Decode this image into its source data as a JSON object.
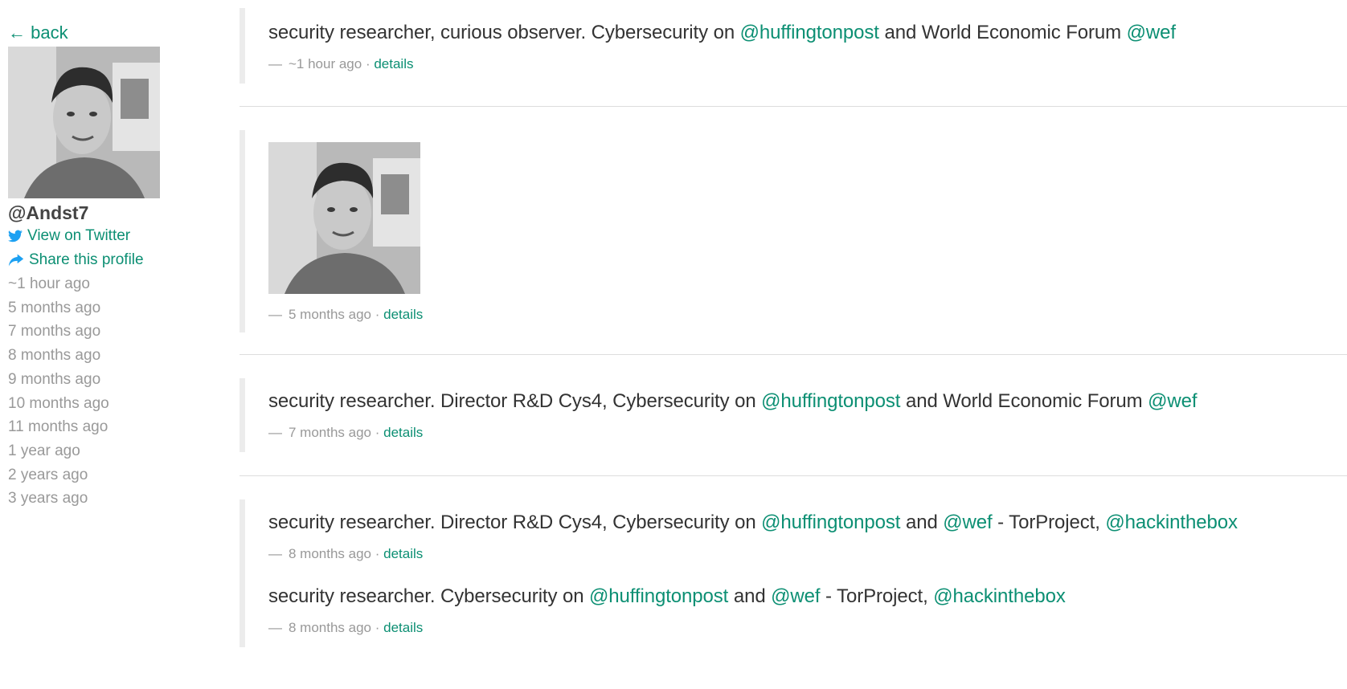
{
  "sidebar": {
    "back": "← back",
    "handle": "@Andst7",
    "view_twitter": "View on Twitter",
    "share_profile": "Share this profile",
    "timeline": [
      "~1 hour ago",
      "5 months ago",
      "7 months ago",
      "8 months ago",
      "9 months ago",
      "10 months ago",
      "11 months ago",
      "1 year ago",
      "2 years ago",
      "3 years ago"
    ]
  },
  "entries": {
    "e1": {
      "bio_pre": "security researcher, curious observer. Cybersecurity on ",
      "m1": "@huffingtonpost",
      "mid": " and World Economic Forum ",
      "m2": "@wef",
      "time": "~1 hour ago",
      "details": "details"
    },
    "e2": {
      "time": "5 months ago",
      "details": "details"
    },
    "e3": {
      "bio_pre": "security researcher. Director R&D Cys4, Cybersecurity on ",
      "m1": "@huffingtonpost",
      "mid": " and World Economic Forum ",
      "m2": "@wef",
      "time": "7 months ago",
      "details": "details"
    },
    "e4": {
      "bio_pre": "security researcher. Director R&D Cys4, Cybersecurity on ",
      "m1": "@huffingtonpost",
      "mid1": " and ",
      "m2": "@wef",
      "mid2": " - TorProject, ",
      "m3": "@hackinthebox",
      "time": "8 months ago",
      "details": "details"
    },
    "e5": {
      "bio_pre": "security researcher. Cybersecurity on ",
      "m1": "@huffingtonpost",
      "mid1": " and ",
      "m2": "@wef",
      "mid2": " - TorProject, ",
      "m3": "@hackinthebox",
      "time": "8 months ago",
      "details": "details"
    }
  },
  "colors": {
    "accent": "#0c8f73",
    "muted": "#999999",
    "text": "#333333",
    "twitter": "#1da1f2"
  },
  "icons": [
    "twitter-icon",
    "share-icon"
  ]
}
